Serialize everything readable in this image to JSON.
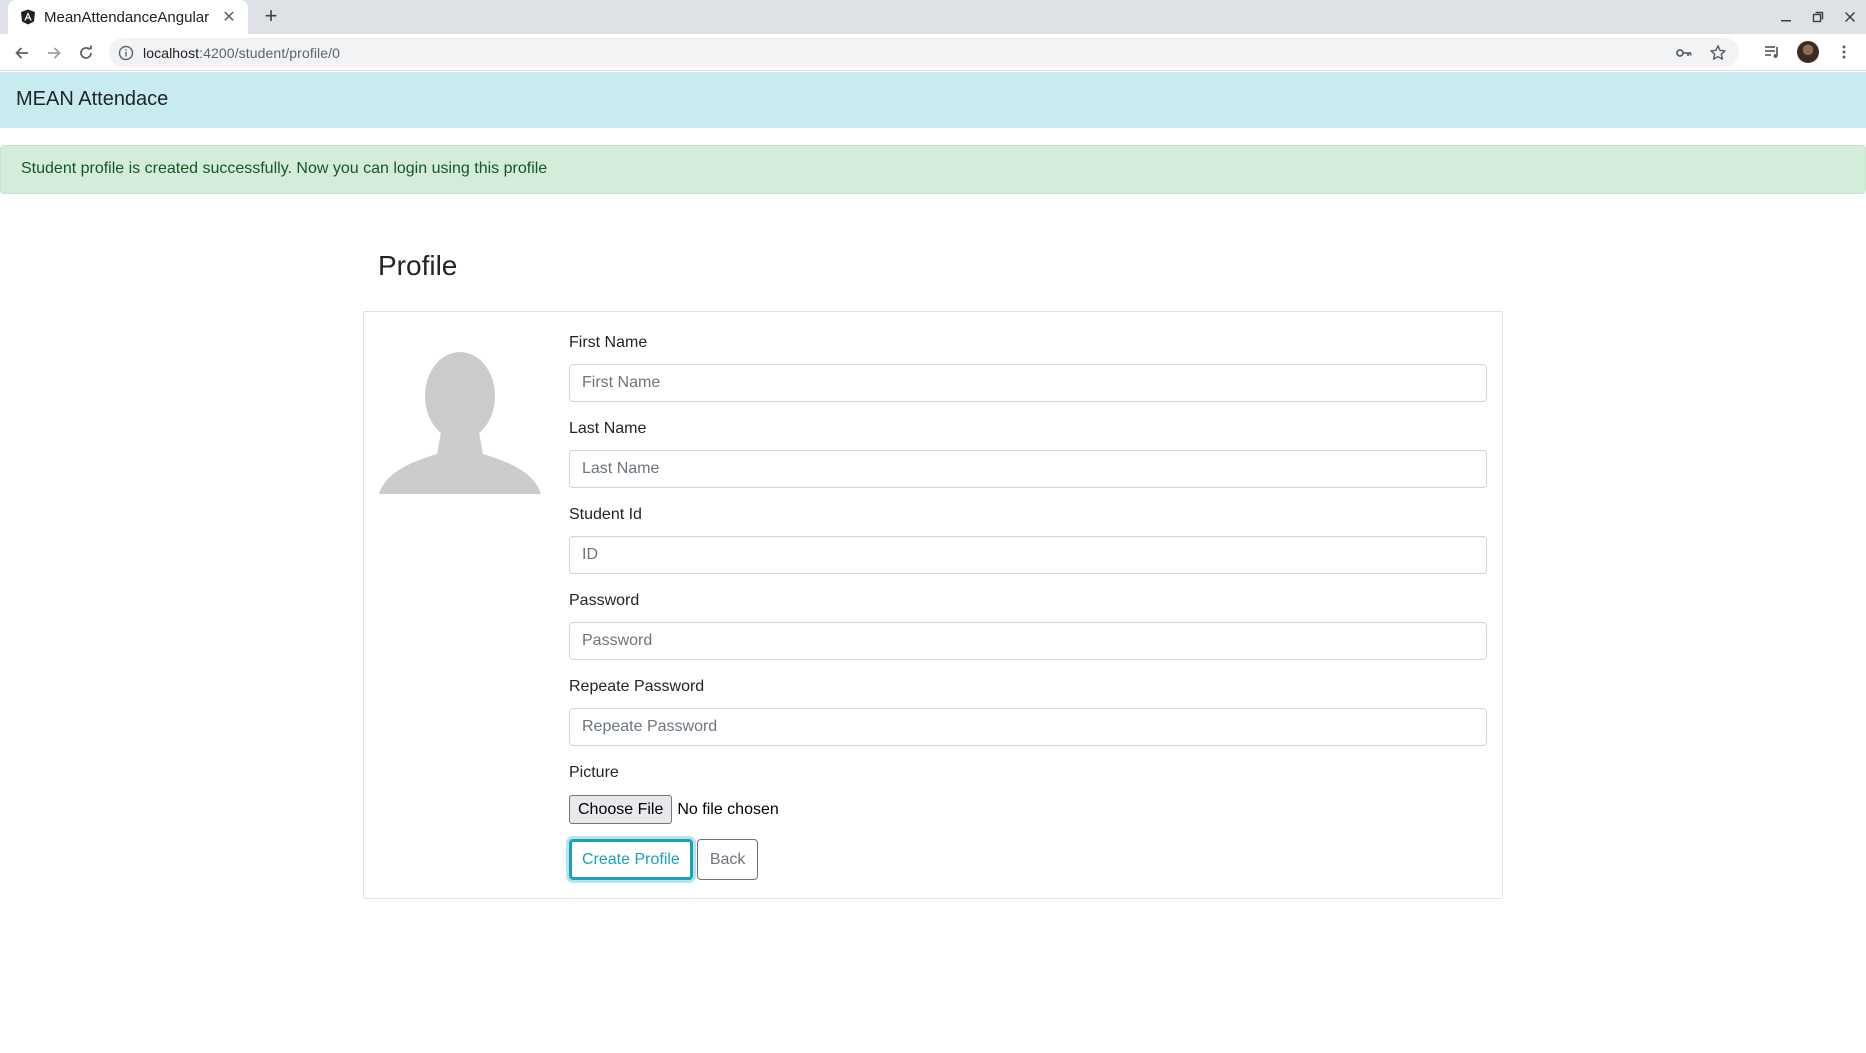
{
  "browser": {
    "tab_title": "MeanAttendanceAngular",
    "url_host": "localhost",
    "url_path": ":4200/student/profile/0"
  },
  "navbar": {
    "brand": "MEAN Attendace"
  },
  "alert": {
    "message": "Student profile is created successfully. Now you can login using this profile"
  },
  "page": {
    "title": "Profile"
  },
  "form": {
    "fields": [
      {
        "label": "First Name",
        "placeholder": "First Name",
        "value": ""
      },
      {
        "label": "Last Name",
        "placeholder": "Last Name",
        "value": ""
      },
      {
        "label": "Student Id",
        "placeholder": "ID",
        "value": ""
      },
      {
        "label": "Password",
        "placeholder": "Password",
        "value": ""
      },
      {
        "label": "Repeate Password",
        "placeholder": "Repeate Password",
        "value": ""
      }
    ],
    "picture_label": "Picture",
    "file_button": "Choose File",
    "file_status": "No file chosen",
    "create_button": "Create Profile",
    "back_button": "Back"
  },
  "colors": {
    "navbar_bg": "#c8ebef",
    "alert_bg": "#d4edda",
    "alert_text": "#155724",
    "accent_info": "#17a2b8",
    "secondary": "#6c757d"
  },
  "icons": [
    "angular-icon",
    "close-icon",
    "plus-icon",
    "minimize-icon",
    "restore-icon",
    "back-arrow-icon",
    "forward-arrow-icon",
    "reload-icon",
    "info-icon",
    "key-icon",
    "star-icon",
    "media-queue-icon",
    "profile-avatar",
    "kebab-menu-icon",
    "default-user-icon"
  ]
}
